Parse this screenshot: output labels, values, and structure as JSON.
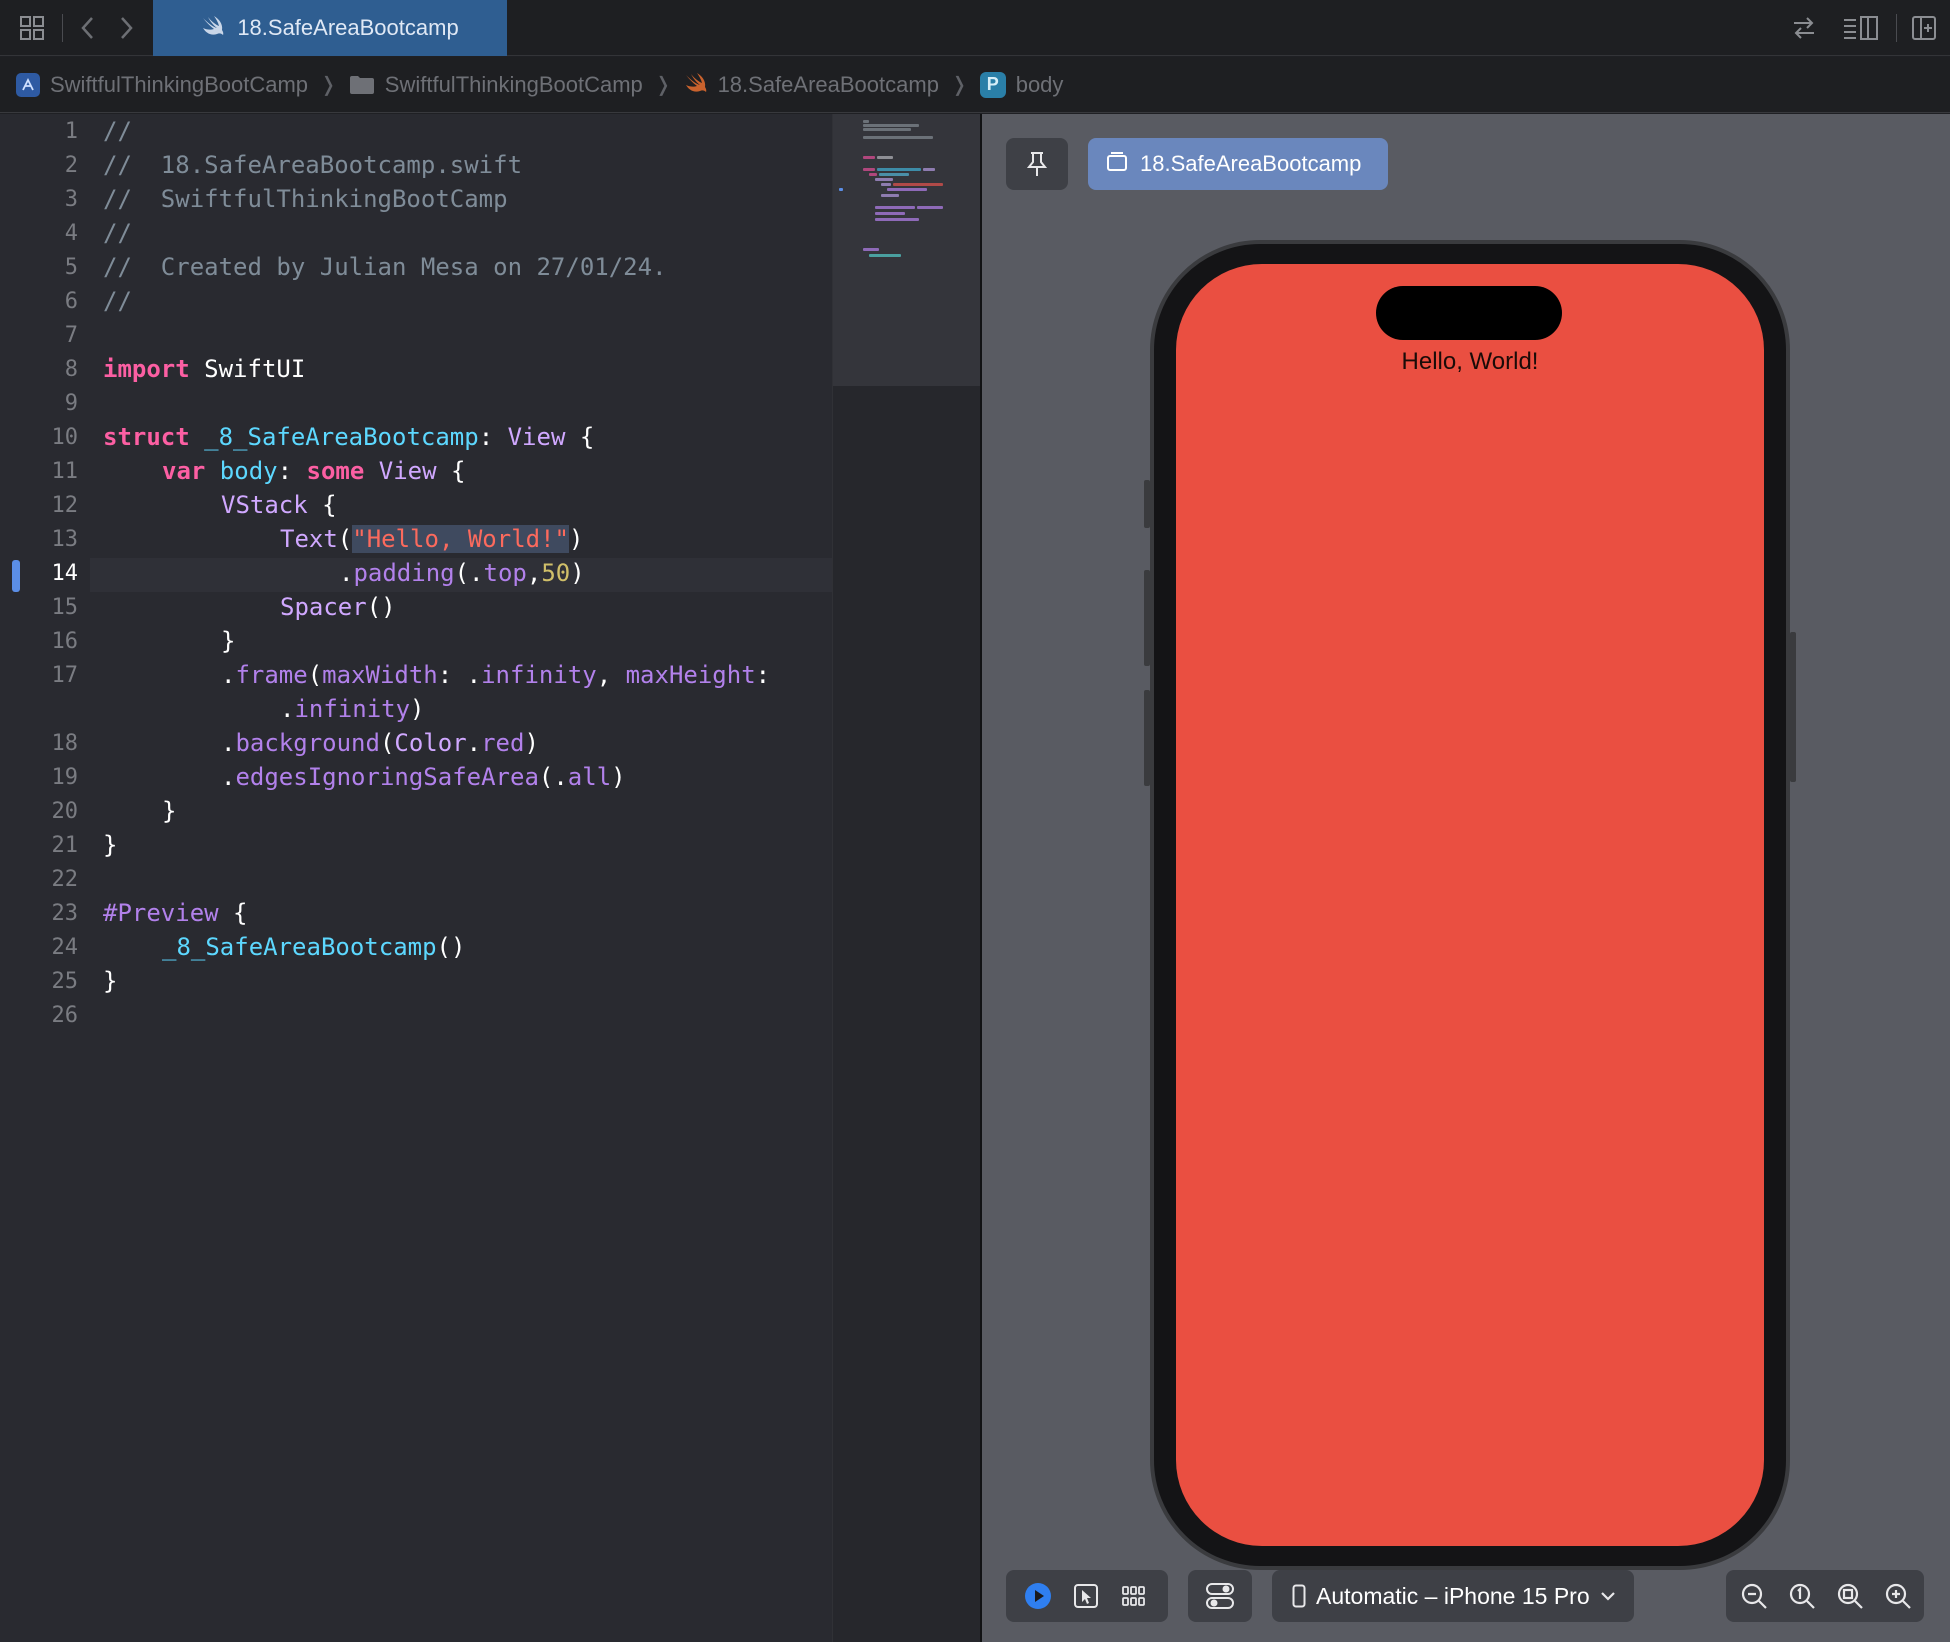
{
  "tabbar": {
    "active_tab": "18.SafeAreaBootcamp"
  },
  "breadcrumb": {
    "project": "SwiftfulThinkingBootCamp",
    "folder": "SwiftfulThinkingBootCamp",
    "file": "18.SafeAreaBootcamp",
    "symbol_badge": "P",
    "symbol": "body"
  },
  "editor": {
    "current_line": 14,
    "line_numbers": [
      "1",
      "2",
      "3",
      "4",
      "5",
      "6",
      "7",
      "8",
      "9",
      "10",
      "11",
      "12",
      "13",
      "14",
      "15",
      "16",
      "17",
      "18",
      "19",
      "20",
      "21",
      "22",
      "23",
      "24",
      "25",
      "26"
    ],
    "code": {
      "l1": "//",
      "l2": "//  18.SafeAreaBootcamp.swift",
      "l3": "//  SwiftfulThinkingBootCamp",
      "l4": "//",
      "l5": "//  Created by Julian Mesa on 27/01/24.",
      "l6": "//",
      "l8_kw": "import",
      "l8_rest": " SwiftUI",
      "l10_kw": "struct",
      "l10_name": " _8_SafeAreaBootcamp",
      "l10_colon": ": ",
      "l10_type": "View",
      "l10_brace": " {",
      "l11_kw": "var",
      "l11_name": " body",
      "l11_colon": ": ",
      "l11_some": "some",
      "l11_type": " View",
      "l11_brace": " {",
      "l12_type": "VStack",
      "l12_brace": " {",
      "l13_type": "Text",
      "l13_open": "(",
      "l13_str": "\"Hello, World!\"",
      "l13_close": ")",
      "l14_dot": ".",
      "l14_fn": "padding",
      "l14_open": "(.",
      "l14_prop": "top",
      "l14_comma": ",",
      "l14_num": "50",
      "l14_close": ")",
      "l15_type": "Spacer",
      "l15_parens": "()",
      "l16": "}",
      "l17_dot": ".",
      "l17_fn": "frame",
      "l17_open": "(",
      "l17_arg1": "maxWidth",
      "l17_c1": ": .",
      "l17_inf1": "infinity",
      "l17_sep": ", ",
      "l17_arg2": "maxHeight",
      "l17_c2": ":",
      "l17b_dot": ".",
      "l17b_inf": "infinity",
      "l17b_close": ")",
      "l18_dot": ".",
      "l18_fn": "background",
      "l18_open": "(",
      "l18_type": "Color",
      "l18_dot2": ".",
      "l18_prop": "red",
      "l18_close": ")",
      "l19_dot": ".",
      "l19_fn": "edgesIgnoringSafeArea",
      "l19_open": "(.",
      "l19_prop": "all",
      "l19_close": ")",
      "l20": "}",
      "l21": "}",
      "l23_macro": "#Preview",
      "l23_brace": " {",
      "l24_type": "_8_SafeAreaBootcamp",
      "l24_parens": "()",
      "l25": "}"
    }
  },
  "preview": {
    "tab_label": "18.SafeAreaBootcamp",
    "screen_text": "Hello, World!",
    "screen_color": "#ea4f41",
    "device_label": "Automatic – iPhone 15 Pro"
  },
  "colors": {
    "accent": "#2f5e91",
    "keyword": "#fc5fa3",
    "type": "#d0a8ff",
    "string": "#fc6a5d",
    "number": "#d0bf69",
    "comment": "#7f8c98"
  }
}
